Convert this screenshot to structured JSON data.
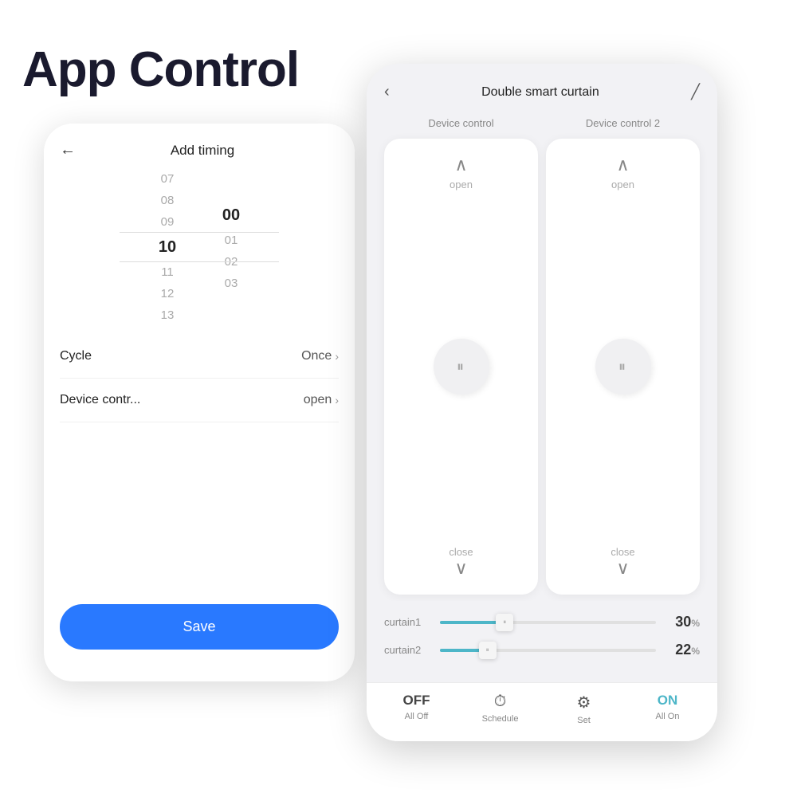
{
  "page": {
    "title": "App Control"
  },
  "left_phone": {
    "header": {
      "back_icon": "←",
      "title": "Add timing"
    },
    "time_picker": {
      "hours": [
        "07",
        "08",
        "09",
        "10",
        "11",
        "12",
        "13"
      ],
      "minutes": [
        "00",
        "01",
        "02",
        "03"
      ],
      "selected_hour": "10",
      "selected_minute": "00"
    },
    "settings": [
      {
        "label": "Cycle",
        "value": "Once"
      },
      {
        "label": "Device contr...",
        "value": "open"
      }
    ],
    "save_button": "Save"
  },
  "right_phone": {
    "header": {
      "back_icon": "‹",
      "title": "Double smart curtain",
      "edit_icon": "╱"
    },
    "device_controls": [
      {
        "label": "Device control",
        "open_label": "open",
        "close_label": "close",
        "up_arrow": "∧",
        "down_arrow": "∨"
      },
      {
        "label": "Device control 2",
        "open_label": "open",
        "close_label": "close",
        "up_arrow": "∧",
        "down_arrow": "∨"
      }
    ],
    "sliders": [
      {
        "name": "curtain1",
        "value": 30,
        "percent": "30%"
      },
      {
        "name": "curtain2",
        "value": 22,
        "percent": "22%"
      }
    ],
    "bottom_bar": [
      {
        "icon": "OFF",
        "label": "All Off",
        "type": "text"
      },
      {
        "icon": "⏱",
        "label": "Schedule",
        "type": "icon"
      },
      {
        "icon": "⚙",
        "label": "Set",
        "type": "icon"
      },
      {
        "icon": "ON",
        "label": "All On",
        "type": "text_on"
      }
    ]
  }
}
